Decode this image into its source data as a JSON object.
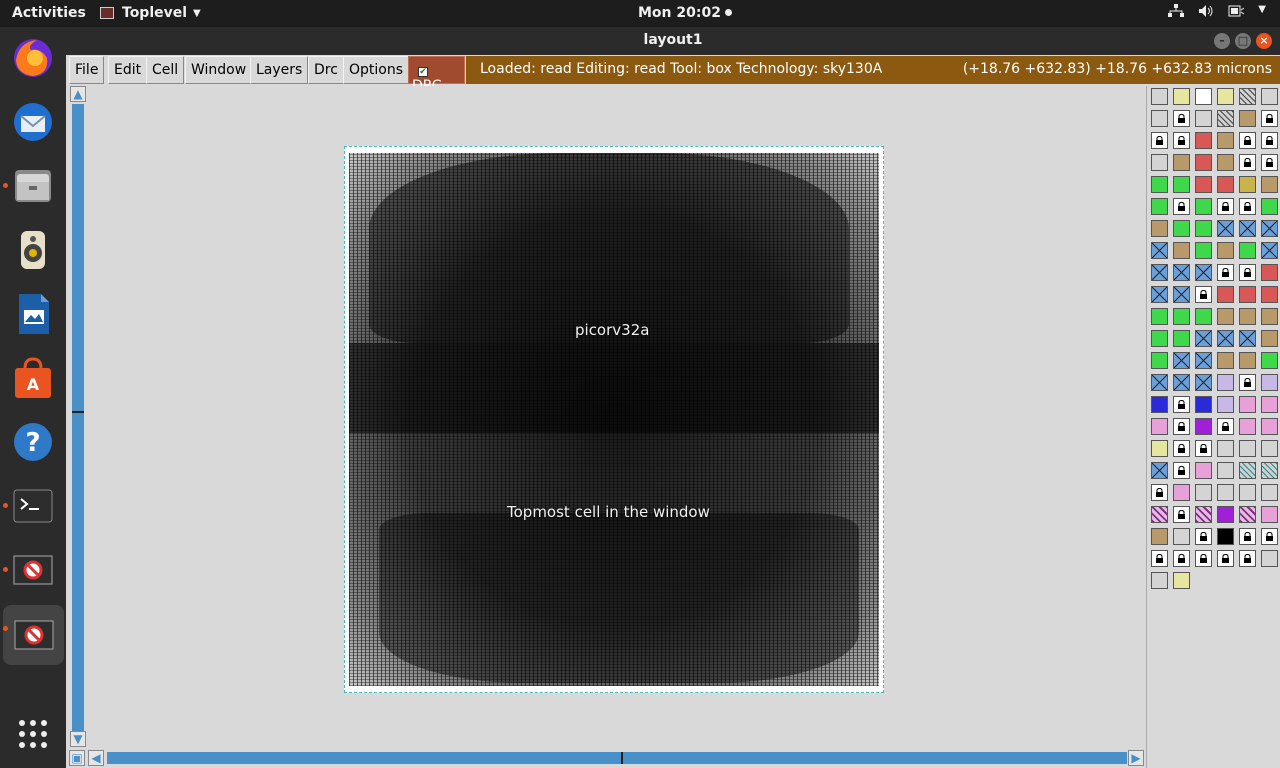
{
  "topbar": {
    "activities": "Activities",
    "app_menu": "Toplevel",
    "clock": "Mon 20:02",
    "tray_icons": [
      "network-icon",
      "volume-icon",
      "battery-icon",
      "system-menu-icon"
    ]
  },
  "dock": {
    "items": [
      {
        "name": "firefox",
        "running": false
      },
      {
        "name": "thunderbird",
        "running": false
      },
      {
        "name": "files",
        "running": true
      },
      {
        "name": "rhythmbox",
        "running": false
      },
      {
        "name": "libreoffice-writer",
        "running": false
      },
      {
        "name": "software-center",
        "running": false
      },
      {
        "name": "help",
        "running": false
      },
      {
        "name": "terminal",
        "running": true
      },
      {
        "name": "magic-window-1",
        "running": true
      },
      {
        "name": "magic-window-2",
        "running": true,
        "active": true
      },
      {
        "name": "show-applications",
        "running": false
      }
    ]
  },
  "window": {
    "title": "layout1"
  },
  "menu": {
    "file": "File",
    "edit": "Edit",
    "cell": "Cell",
    "window": "Window",
    "layers": "Layers",
    "drc": "Drc",
    "options": "Options",
    "drc_toggle": "DRC"
  },
  "status": {
    "info": "Loaded: read Editing: read Tool: box  Technology: sky130A",
    "coords": "(+18.76 +632.83) +18.76 +632.83 microns"
  },
  "layout": {
    "cell_name": "picorv32a",
    "top_cell_label": "Topmost cell in the window"
  },
  "colors": {
    "drc_bg": "#a04a30",
    "status_bg": "#8b5a10",
    "scroll_track": "#4a90c8"
  }
}
